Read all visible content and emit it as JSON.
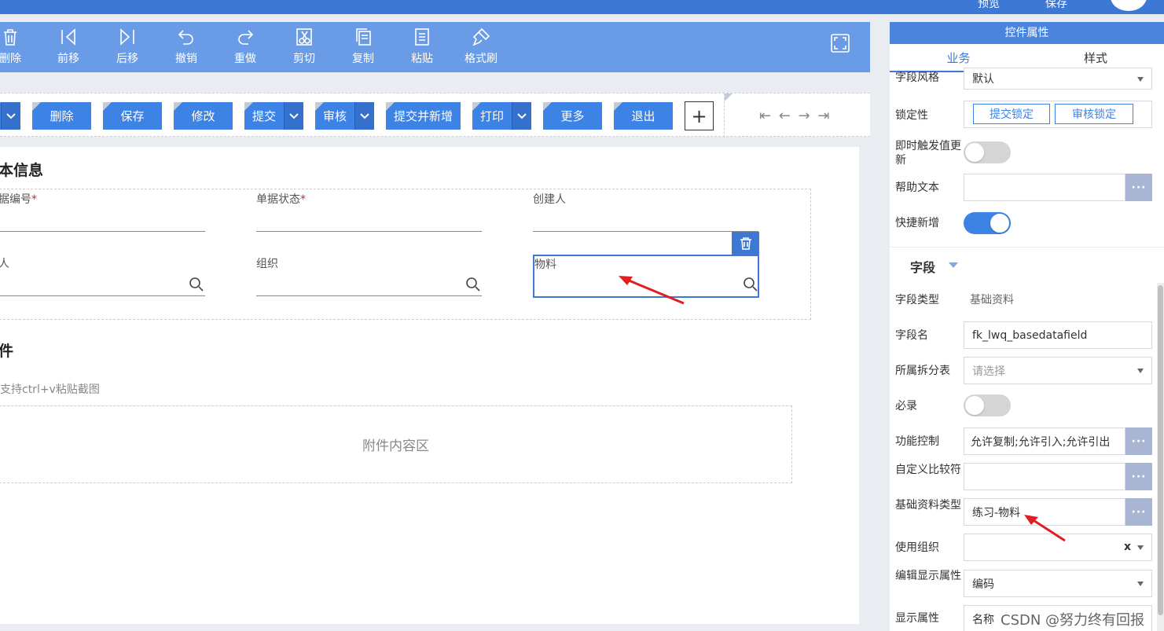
{
  "topbar": {
    "preview_label": "预览",
    "save_label": "保存"
  },
  "toolbar": {
    "tools": [
      {
        "label": "删除",
        "icon": "trash-icon"
      },
      {
        "label": "前移",
        "icon": "move-prev-icon"
      },
      {
        "label": "后移",
        "icon": "move-next-icon"
      },
      {
        "label": "撤销",
        "icon": "undo-icon"
      },
      {
        "label": "重做",
        "icon": "redo-icon"
      },
      {
        "label": "剪切",
        "icon": "cut-icon"
      },
      {
        "label": "复制",
        "icon": "copy-icon"
      },
      {
        "label": "粘贴",
        "icon": "paste-icon"
      },
      {
        "label": "格式刷",
        "icon": "format-brush-icon"
      }
    ]
  },
  "buttons": {
    "delete": "删除",
    "save": "保存",
    "modify": "修改",
    "submit": "提交",
    "audit": "审核",
    "submit_new": "提交并新增",
    "print": "打印",
    "more": "更多",
    "exit": "退出",
    "plus": "+",
    "nav": "⇤ ← → ⇥"
  },
  "form": {
    "section_basic": "本信息",
    "fields": {
      "bill_no": "据编号",
      "bill_status": "单据状态",
      "creator": "创建人",
      "person": "人",
      "org": "组织",
      "material": "物料"
    },
    "required_mark": "*",
    "section_attach": "件",
    "attach_hint": "支持ctrl+v粘贴截图",
    "attach_zone": "附件内容区"
  },
  "right_panel": {
    "header": "控件属性",
    "tabs": {
      "business": "业务",
      "style": "样式"
    },
    "field_style_label": "字段风格",
    "field_style_value": "默认",
    "lock_label": "锁定性",
    "lock_submit": "提交锁定",
    "lock_audit": "审核锁定",
    "instant_update_label": "即时触发值更新",
    "help_text_label": "帮助文本",
    "quick_add_label": "快捷新增",
    "section_field": "字段",
    "field_type_label": "字段类型",
    "field_type_value": "基础资料",
    "field_name_label": "字段名",
    "field_name_value": "fk_lwq_basedatafield",
    "split_table_label": "所属拆分表",
    "split_table_placeholder": "请选择",
    "required_label": "必录",
    "func_control_label": "功能控制",
    "func_control_value": "允许复制;允许引入;允许引出",
    "custom_compare_label": "自定义比较符",
    "basedata_type_label": "基础资料类型",
    "basedata_type_value": "练习-物料",
    "use_org_label": "使用组织",
    "use_org_clear": "x",
    "edit_display_label": "编辑显示属性",
    "edit_display_value": "编码",
    "display_prop_label": "显示属性",
    "display_prop_value": "名称",
    "more_btn": "···"
  },
  "toggles": {
    "instant_update": false,
    "quick_add": true,
    "required": false
  },
  "watermark": "CSDN @努力终有回报",
  "colors": {
    "primary": "#3d78d4",
    "toolbar": "#6a9be6",
    "button": "#3d83e6",
    "arrow": "#e02020"
  }
}
